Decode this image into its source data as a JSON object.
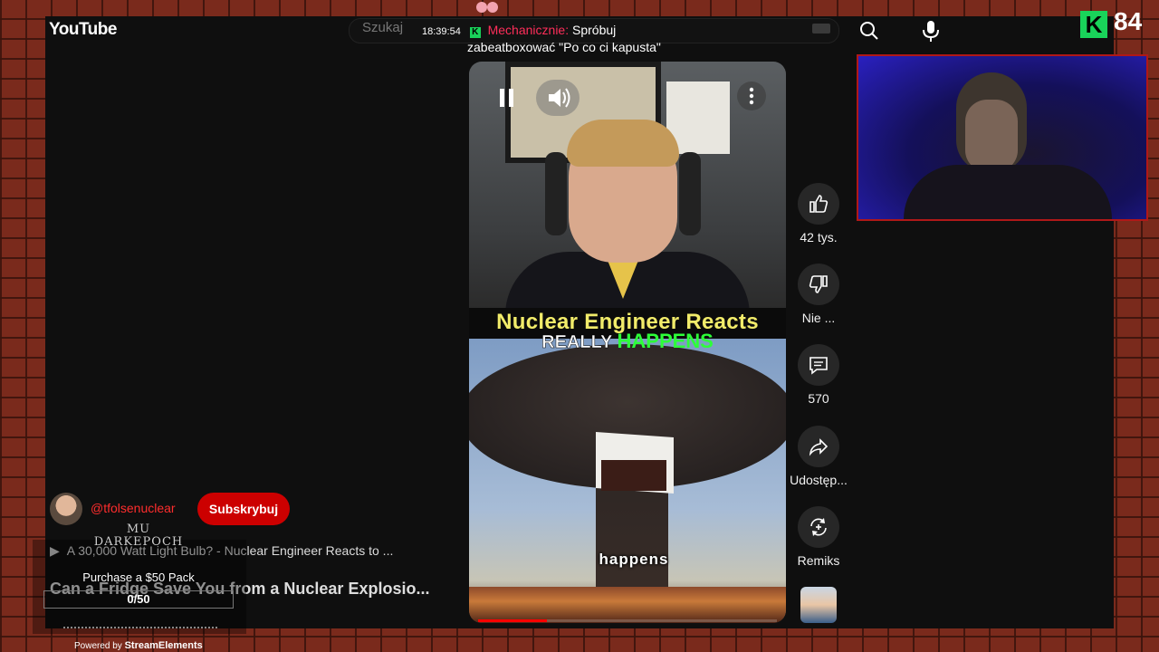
{
  "header": {
    "logo": "YouTube",
    "search_placeholder": "Szukaj",
    "icons": [
      "keyboard-icon",
      "search-icon",
      "microphone-icon"
    ]
  },
  "chat": {
    "timestamp": "18:39:54",
    "badge": "K",
    "username": "Mechanicznie:",
    "message_part1": "Spróbuj",
    "message_part2": "zabeatboxować \"Po co ci kapusta\""
  },
  "stream_overlay": {
    "platform_badge": "K",
    "viewer_count": "84",
    "game_logo": "MU DARKEPOCH",
    "goal_label": "Purchase a $50 Pack",
    "goal_progress": "0/50",
    "goal_fraction": 0.0,
    "powered_prefix": "Powered by",
    "powered_brand": "StreamElements"
  },
  "short": {
    "caption_top": "Nuclear Engineer Reacts",
    "caption_mid_white": "REALLY",
    "caption_mid_green": "HAPPENS",
    "caption_bottom": "happens",
    "progress_fraction": 0.23
  },
  "actions": {
    "like_count": "42 tys.",
    "dislike_label": "Nie ...",
    "comment_count": "570",
    "share_label": "Udostęp...",
    "remix_label": "Remiks"
  },
  "channel": {
    "handle": "@tfolsenuclear",
    "subscribe_label": "Subskrybuj",
    "related_1": "A 30,000 Watt Light Bulb? - Nuclear Engineer Reacts to ...",
    "related_2": "Can a Fridge Save You from a Nuclear Explosio..."
  },
  "colors": {
    "accent_red": "#cc0000",
    "kick_green": "#19d35a",
    "caption_yellow": "#f2ec6a",
    "caption_green": "#2dff39"
  }
}
